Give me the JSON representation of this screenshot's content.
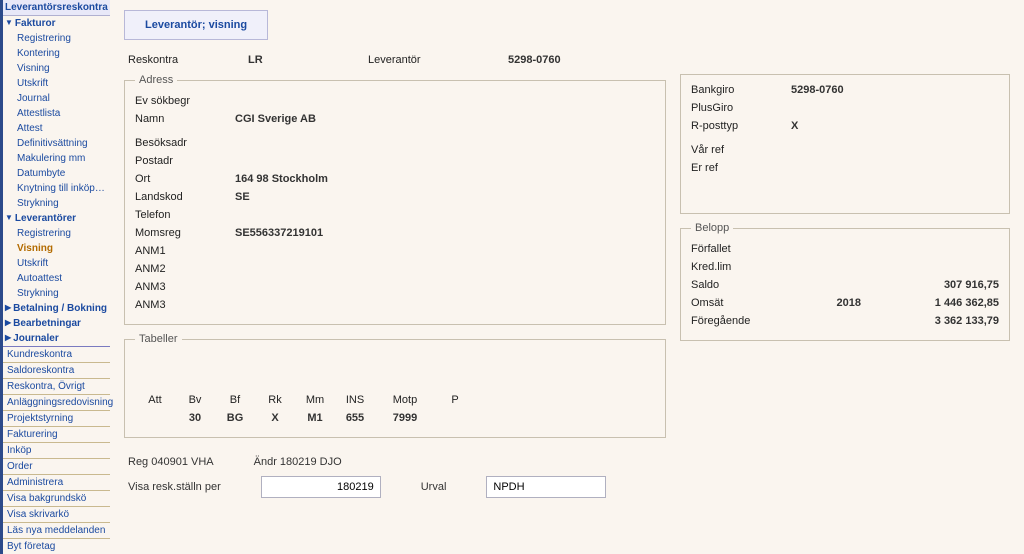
{
  "sidebar": {
    "top": "Leverantörsreskontra",
    "fakturor": {
      "title": "Fakturor",
      "items": [
        "Registrering",
        "Kontering",
        "Visning",
        "Utskrift",
        "Journal",
        "Attestlista",
        "Attest",
        "Definitivsättning",
        "Makulering mm",
        "Datumbyte",
        "Knytning till inköpsorder",
        "Strykning"
      ]
    },
    "leverantorer": {
      "title": "Leverantörer",
      "items": [
        "Registrering",
        "Visning",
        "Utskrift",
        "Autoattest",
        "Strykning"
      ],
      "activeIndex": 1
    },
    "collapsed": [
      "Betalning / Bokning",
      "Bearbetningar",
      "Journaler"
    ],
    "links": [
      "Kundreskontra",
      "Saldoreskontra",
      "Reskontra, Övrigt",
      "Anläggningsredovisning",
      "Projektstyrning",
      "Fakturering",
      "Inköp",
      "Order",
      "Administrera",
      "Visa bakgrundskö",
      "Visa skrivarkö",
      "Läs nya meddelanden",
      "Byt företag"
    ]
  },
  "tab": "Leverantör; visning",
  "header": {
    "lbl1": "Reskontra",
    "val1": "LR",
    "lbl2": "Leverantör",
    "val2": "5298-0760"
  },
  "adress": {
    "legend": "Adress",
    "rows": [
      {
        "lbl": "Ev sökbegr",
        "val": ""
      },
      {
        "lbl": "Namn",
        "val": "CGI Sverige AB"
      },
      {
        "lbl": "",
        "val": ""
      },
      {
        "lbl": "Besöksadr",
        "val": ""
      },
      {
        "lbl": "Postadr",
        "val": ""
      },
      {
        "lbl": "Ort",
        "val": "164 98 Stockholm"
      },
      {
        "lbl": "Landskod",
        "val": "SE"
      },
      {
        "lbl": "Telefon",
        "val": ""
      },
      {
        "lbl": "Momsreg",
        "val": "SE556337219101"
      },
      {
        "lbl": "ANM1",
        "val": ""
      },
      {
        "lbl": "ANM2",
        "val": ""
      },
      {
        "lbl": "ANM3",
        "val": ""
      },
      {
        "lbl": "ANM3",
        "val": ""
      }
    ]
  },
  "info": {
    "rows": [
      {
        "lbl": "Bankgiro",
        "val": "5298-0760"
      },
      {
        "lbl": "PlusGiro",
        "val": ""
      },
      {
        "lbl": "R-posttyp",
        "val": "X"
      },
      {
        "lbl": "",
        "val": ""
      },
      {
        "lbl": "Vår ref",
        "val": ""
      },
      {
        "lbl": "Er ref",
        "val": ""
      }
    ]
  },
  "belopp": {
    "legend": "Belopp",
    "rows": [
      {
        "lbl": "Förfallet",
        "mid": "",
        "val": ""
      },
      {
        "lbl": "Kred.lim",
        "mid": "",
        "val": ""
      },
      {
        "lbl": "Saldo",
        "mid": "",
        "val": "307 916,75"
      },
      {
        "lbl": "Omsät",
        "mid": "2018",
        "val": "1 446 362,85"
      },
      {
        "lbl": "Föregående",
        "mid": "",
        "val": "3 362 133,79"
      }
    ]
  },
  "tabeller": {
    "legend": "Tabeller",
    "head": [
      "Att",
      "Bv",
      "Bf",
      "Rk",
      "Mm",
      "INS",
      "Motp",
      "P"
    ],
    "row": [
      "",
      "30",
      "BG",
      "X",
      "M1",
      "655",
      "7999",
      ""
    ]
  },
  "footer": {
    "reg": "Reg 040901 VHA",
    "andr": "Ändr 180219 DJO",
    "visa_lbl": "Visa resk.ställn per",
    "visa_val": "180219",
    "urval_lbl": "Urval",
    "urval_val": "NPDH"
  }
}
